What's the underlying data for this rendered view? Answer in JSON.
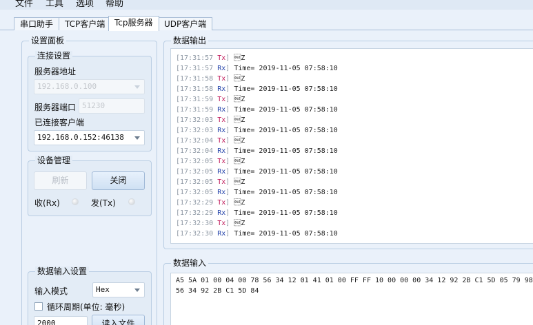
{
  "menu": {
    "items": [
      "文件",
      "工具",
      "选项",
      "帮助"
    ]
  },
  "tabs": [
    {
      "label": "串口助手"
    },
    {
      "label": "TCP客户端"
    },
    {
      "label": "Tcp服务器"
    },
    {
      "label": "UDP客户端"
    }
  ],
  "settings_panel": {
    "title": "设置面板",
    "connection": {
      "title": "连接设置",
      "server_address_label": "服务器地址",
      "server_address_value": "192.168.0.100",
      "server_port_label": "服务器端口",
      "server_port_value": "51230",
      "connected_clients_label": "已连接客户端",
      "connected_client_value": "192.168.0.152:46138"
    },
    "device": {
      "title": "设备管理",
      "refresh_label": "刷新",
      "close_label": "关闭",
      "rx_label": "收(Rx)",
      "tx_label": "发(Tx)"
    },
    "data_input_settings": {
      "title": "数据输入设置",
      "input_mode_label": "输入模式",
      "input_mode_value": "Hex",
      "loop_period_label": "循环周期(单位: 毫秒)",
      "period_value": "2000",
      "read_file_label": "读入文件"
    }
  },
  "output": {
    "title": "数据输出",
    "lines": [
      {
        "time": "[17:31:57",
        "dir": "Tx",
        "text": "\u0010Z"
      },
      {
        "time": "[17:31:57",
        "dir": "Rx",
        "text": "Time= 2019-11-05 07:58:10"
      },
      {
        "time": "[17:31:58",
        "dir": "Tx",
        "text": "\u0010Z"
      },
      {
        "time": "[17:31:58",
        "dir": "Rx",
        "text": "Time= 2019-11-05 07:58:10"
      },
      {
        "time": "[17:31:59",
        "dir": "Tx",
        "text": "\u0010Z"
      },
      {
        "time": "[17:31:59",
        "dir": "Rx",
        "text": "Time= 2019-11-05 07:58:10"
      },
      {
        "time": "[17:32:03",
        "dir": "Tx",
        "text": "\u0010Z"
      },
      {
        "time": "[17:32:03",
        "dir": "Rx",
        "text": "Time= 2019-11-05 07:58:10"
      },
      {
        "time": "[17:32:04",
        "dir": "Tx",
        "text": "\u0010Z"
      },
      {
        "time": "[17:32:04",
        "dir": "Rx",
        "text": "Time= 2019-11-05 07:58:10"
      },
      {
        "time": "[17:32:05",
        "dir": "Tx",
        "text": "\u0010Z"
      },
      {
        "time": "[17:32:05",
        "dir": "Rx",
        "text": "Time= 2019-11-05 07:58:10"
      },
      {
        "time": "[17:32:05",
        "dir": "Tx",
        "text": "\u0010Z"
      },
      {
        "time": "[17:32:05",
        "dir": "Rx",
        "text": "Time= 2019-11-05 07:58:10"
      },
      {
        "time": "[17:32:29",
        "dir": "Tx",
        "text": "\u0010Z"
      },
      {
        "time": "[17:32:29",
        "dir": "Rx",
        "text": "Time= 2019-11-05 07:58:10"
      },
      {
        "time": "[17:32:30",
        "dir": "Tx",
        "text": "\u0010Z"
      },
      {
        "time": "[17:32:30",
        "dir": "Rx",
        "text": "Time= 2019-11-05 07:58:10"
      }
    ]
  },
  "input": {
    "title": "数据输入",
    "value": "A5 5A 01 00 04 00 78 56 34 12 01 41 01 00 FF FF 10 00 00 00 34 12 92 2B C1 5D 05 79 98 56 34 92 2B C1 5D 84"
  },
  "colors": {
    "tx": "#c0195a",
    "rx": "#1f3fa8",
    "timestamp": "#8e98a4",
    "window_bg": "#eaf1fa"
  }
}
